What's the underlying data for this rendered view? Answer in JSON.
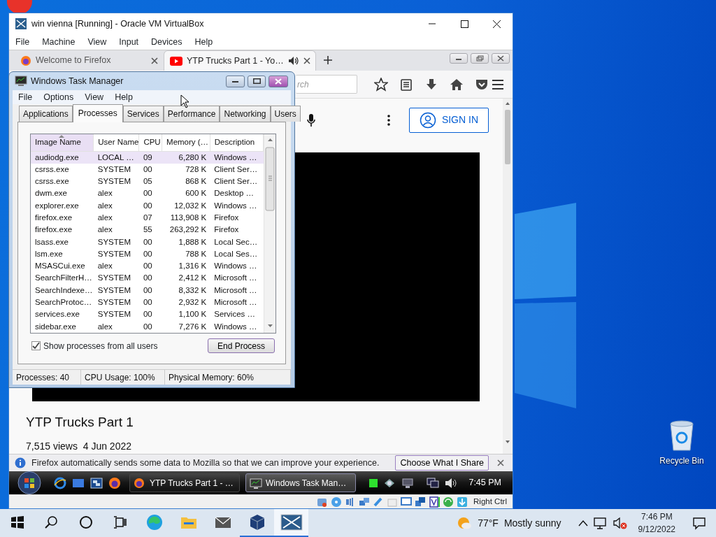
{
  "desktop": {
    "icons": [
      {
        "label": "Recycle Bin"
      }
    ]
  },
  "vbox_window": {
    "title": "win vienna [Running] - Oracle VM VirtualBox",
    "menu": [
      "File",
      "Machine",
      "View",
      "Input",
      "Devices",
      "Help"
    ]
  },
  "firefox": {
    "tabs": [
      {
        "label": "Welcome to Firefox",
        "selected": false,
        "playing_audio": false
      },
      {
        "label": "YTP Trucks Part 1 - Yo…",
        "selected": true,
        "playing_audio": true
      }
    ],
    "search": {
      "placeholder": "rch"
    },
    "sign_in": "SIGN IN",
    "video_title": "YTP Trucks Part 1",
    "video_meta": "7,515 views  4 Jun 2022",
    "notification": {
      "text": "Firefox automatically sends some data to Mozilla so that we can improve your experience.",
      "button": "Choose What I Share"
    }
  },
  "task_manager": {
    "title": "Windows Task Manager",
    "menu": [
      "File",
      "Options",
      "View",
      "Help"
    ],
    "tabs": [
      {
        "label": "Applications",
        "selected": false
      },
      {
        "label": "Processes",
        "selected": true
      },
      {
        "label": "Services",
        "selected": false
      },
      {
        "label": "Performance",
        "selected": false
      },
      {
        "label": "Networking",
        "selected": false
      },
      {
        "label": "Users",
        "selected": false
      }
    ],
    "columns": [
      {
        "label": "Image Name",
        "sorted": true
      },
      {
        "label": "User Name",
        "sorted": false
      },
      {
        "label": "CPU",
        "sorted": false
      },
      {
        "label": "Memory (…",
        "sorted": false
      },
      {
        "label": "Description",
        "sorted": false
      }
    ],
    "rows": [
      {
        "cells": [
          "audiodg.exe",
          "LOCAL …",
          "09",
          "6,280 K",
          "Windows …"
        ],
        "selected": true
      },
      {
        "cells": [
          "csrss.exe",
          "SYSTEM",
          "00",
          "728 K",
          "Client Ser…"
        ],
        "selected": false
      },
      {
        "cells": [
          "csrss.exe",
          "SYSTEM",
          "05",
          "868 K",
          "Client Ser…"
        ],
        "selected": false
      },
      {
        "cells": [
          "dwm.exe",
          "alex",
          "00",
          "600 K",
          "Desktop …"
        ],
        "selected": false
      },
      {
        "cells": [
          "explorer.exe",
          "alex",
          "00",
          "12,032 K",
          "Windows …"
        ],
        "selected": false
      },
      {
        "cells": [
          "firefox.exe",
          "alex",
          "07",
          "113,908 K",
          "Firefox"
        ],
        "selected": false
      },
      {
        "cells": [
          "firefox.exe",
          "alex",
          "55",
          "263,292 K",
          "Firefox"
        ],
        "selected": false
      },
      {
        "cells": [
          "lsass.exe",
          "SYSTEM",
          "00",
          "1,888 K",
          "Local Sec…"
        ],
        "selected": false
      },
      {
        "cells": [
          "lsm.exe",
          "SYSTEM",
          "00",
          "788 K",
          "Local Ses…"
        ],
        "selected": false
      },
      {
        "cells": [
          "MSASCui.exe",
          "alex",
          "00",
          "1,316 K",
          "Windows …"
        ],
        "selected": false
      },
      {
        "cells": [
          "SearchFilterH…",
          "SYSTEM",
          "00",
          "2,412 K",
          "Microsoft …"
        ],
        "selected": false
      },
      {
        "cells": [
          "SearchIndexe…",
          "SYSTEM",
          "00",
          "8,332 K",
          "Microsoft …"
        ],
        "selected": false
      },
      {
        "cells": [
          "SearchProtoc…",
          "SYSTEM",
          "00",
          "2,932 K",
          "Microsoft …"
        ],
        "selected": false
      },
      {
        "cells": [
          "services.exe",
          "SYSTEM",
          "00",
          "1,100 K",
          "Services …"
        ],
        "selected": false
      },
      {
        "cells": [
          "sidebar.exe",
          "alex",
          "00",
          "7,276 K",
          "Windows …"
        ],
        "selected": false
      }
    ],
    "show_all_users": {
      "label": "Show processes from all users",
      "checked": true
    },
    "end_process": "End Process",
    "status": [
      "Processes: 40",
      "CPU Usage: 100%",
      "Physical Memory: 60%"
    ]
  },
  "vista_taskbar": {
    "windows": [
      {
        "label": "YTP Trucks Part 1 - …",
        "kind": "firefox",
        "selected": false
      },
      {
        "label": "Windows Task Man…",
        "kind": "taskmgr",
        "selected": true
      }
    ],
    "clock": "7:45 PM"
  },
  "vbox_status": {
    "host_key": "Right Ctrl"
  },
  "taskbar": {
    "apps": [
      {
        "kind": "edge",
        "running": false,
        "selected": false
      },
      {
        "kind": "explorer",
        "running": false,
        "selected": false
      },
      {
        "kind": "mail",
        "running": false,
        "selected": false
      },
      {
        "kind": "virtualbox",
        "running": true,
        "selected": false
      },
      {
        "kind": "vista",
        "running": true,
        "selected": true
      }
    ],
    "weather": {
      "temperature": "77°F",
      "condition": "Mostly sunny"
    },
    "time": "7:46 PM",
    "date": "9/12/2022"
  }
}
